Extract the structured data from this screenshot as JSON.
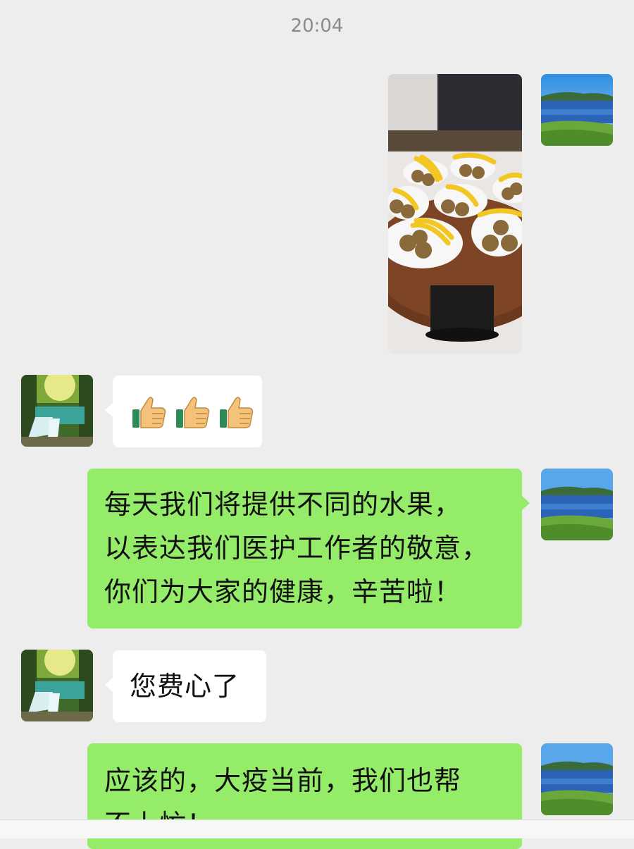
{
  "timestamp": "20:04",
  "messages": [
    {
      "sender": "self",
      "type": "image",
      "content_icon": "fruit-plates-photo"
    },
    {
      "sender": "other",
      "type": "emoji",
      "content_icon": "thumbs-up-icon",
      "count": 3
    },
    {
      "sender": "self",
      "type": "text",
      "text": "每天我们将提供不同的水果，\n以表达我们医护工作者的敬意，\n你们为大家的健康，辛苦啦！"
    },
    {
      "sender": "other",
      "type": "text",
      "text": "您费心了"
    },
    {
      "sender": "self",
      "type": "text",
      "text": "应该的，大疫当前，我们也帮\n不上忙！"
    }
  ],
  "avatars": {
    "self_icon": "lake-landscape-avatar",
    "other_icon": "waterfall-landscape-avatar"
  },
  "colors": {
    "background": "#ededed",
    "self_bubble": "#95ec69",
    "other_bubble": "#ffffff",
    "timestamp_text": "#8a8a8a"
  }
}
